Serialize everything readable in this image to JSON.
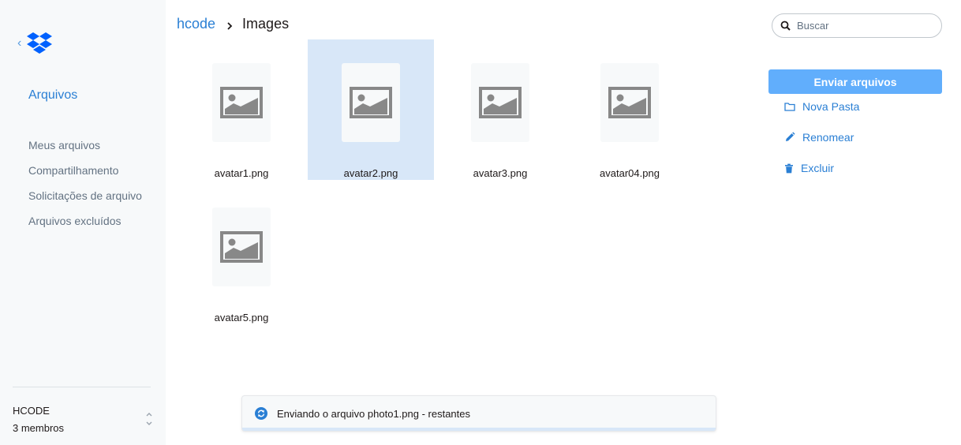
{
  "sidebar": {
    "title": "Arquivos",
    "items": [
      {
        "label": "Meus arquivos"
      },
      {
        "label": "Compartilhamento"
      },
      {
        "label": "Solicitações de arquivo"
      },
      {
        "label": "Arquivos excluídos"
      }
    ],
    "team": {
      "name": "HCODE",
      "members": "3 membros"
    }
  },
  "breadcrumb": {
    "root": "hcode",
    "current": "Images"
  },
  "files": [
    {
      "name": "avatar1.png",
      "selected": false
    },
    {
      "name": "avatar2.png",
      "selected": true
    },
    {
      "name": "avatar3.png",
      "selected": false
    },
    {
      "name": "avatar04.png",
      "selected": false
    },
    {
      "name": "avatar5.png",
      "selected": false
    }
  ],
  "search": {
    "placeholder": "Buscar",
    "value": ""
  },
  "actions": {
    "upload": "Enviar arquivos",
    "new_folder": "Nova Pasta",
    "rename": "Renomear",
    "delete": "Excluir"
  },
  "upload_status": {
    "text": "Enviando o arquivo photo1.png - restantes"
  },
  "colors": {
    "accent": "#2a7fd4",
    "button": "#61aefc",
    "selection": "#d8e7f8",
    "dropbox": "#0061fe"
  },
  "icons": {
    "logo": "dropbox-logo-icon",
    "back": "chevron-left-icon",
    "breadcrumb_separator": "chevron-right-icon",
    "thumbnail": "image-placeholder-icon",
    "search": "search-icon",
    "new_folder": "folder-icon",
    "rename": "pencil-icon",
    "delete": "trash-icon",
    "team_switch": "up-down-chevron-icon",
    "upload_status": "sync-icon"
  }
}
